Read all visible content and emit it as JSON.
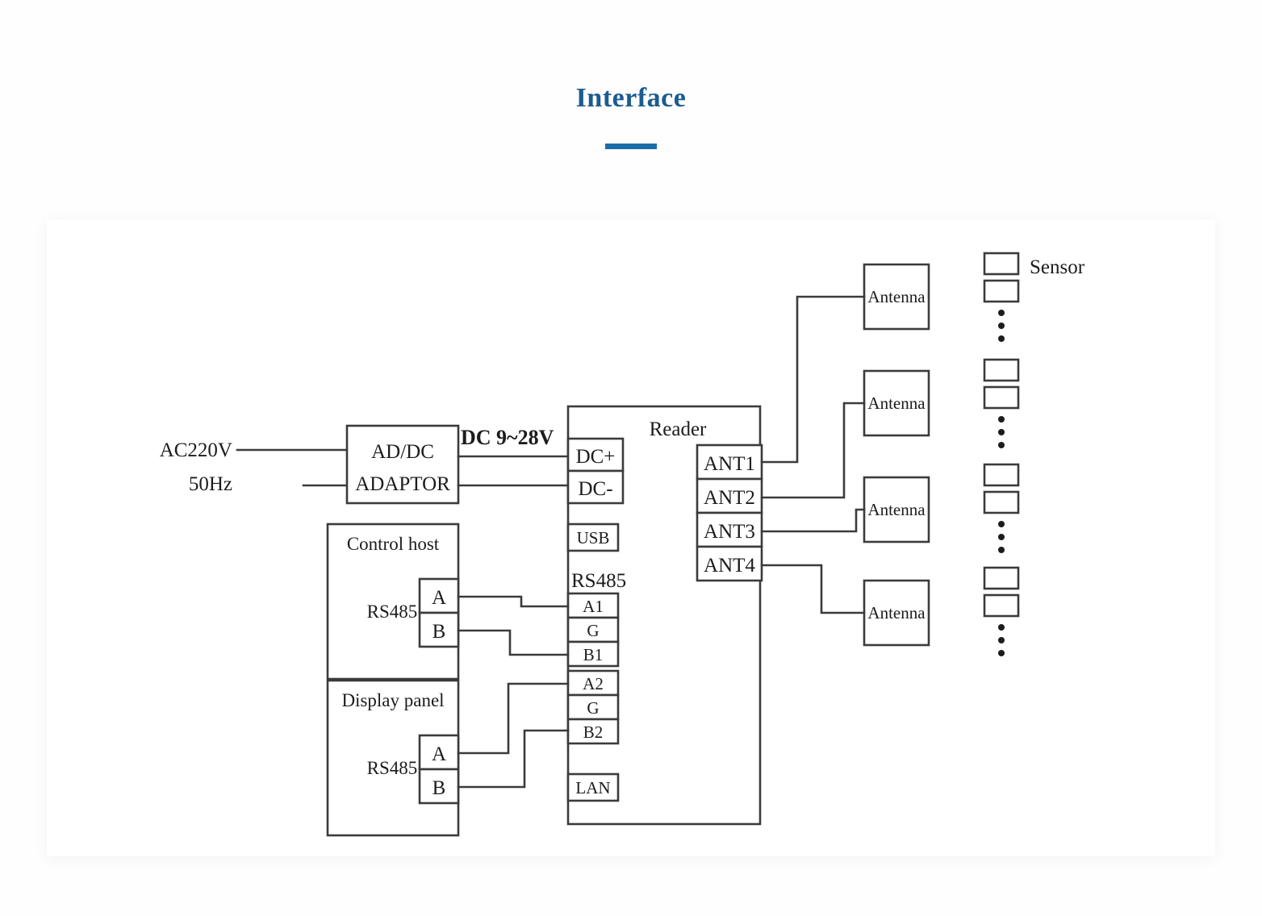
{
  "page": {
    "title": "Interface",
    "accent_color": "#1b5c91",
    "rule_color": "#1b6da8",
    "background": "#fefefe",
    "card_background": "#ffffff",
    "line_color": "#3b3b3b"
  },
  "diagram": {
    "type": "block-wiring-diagram",
    "power": {
      "source_line_1": "AC220V",
      "source_line_2": "50Hz",
      "adaptor_line_1": "AD/DC",
      "adaptor_line_2": "ADAPTOR",
      "output_label": "DC 9~28V"
    },
    "reader": {
      "title": "Reader",
      "rs485_label": "RS485",
      "power_terminals": [
        "DC+",
        "DC-"
      ],
      "usb_terminal": "USB",
      "rs485_group_1": [
        "A1",
        "G",
        "B1"
      ],
      "rs485_group_2": [
        "A2",
        "G",
        "B2"
      ],
      "lan_terminal": "LAN",
      "antenna_terminals": [
        "ANT1",
        "ANT2",
        "ANT3",
        "ANT4"
      ]
    },
    "control_host": {
      "title": "Control host",
      "bus_label": "RS485",
      "terminals": [
        "A",
        "B"
      ]
    },
    "display_panel": {
      "title": "Display panel",
      "bus_label": "RS485",
      "terminals": [
        "A",
        "B"
      ]
    },
    "antennas": [
      {
        "label": "Antenna"
      },
      {
        "label": "Antenna"
      },
      {
        "label": "Antenna"
      },
      {
        "label": "Antenna"
      }
    ],
    "sensors": {
      "label": "Sensor",
      "groups": [
        {
          "boxes": 2,
          "continuation_dots": 3
        },
        {
          "boxes": 2,
          "continuation_dots": 3
        },
        {
          "boxes": 2,
          "continuation_dots": 3
        },
        {
          "boxes": 2,
          "continuation_dots": 3
        }
      ]
    }
  }
}
